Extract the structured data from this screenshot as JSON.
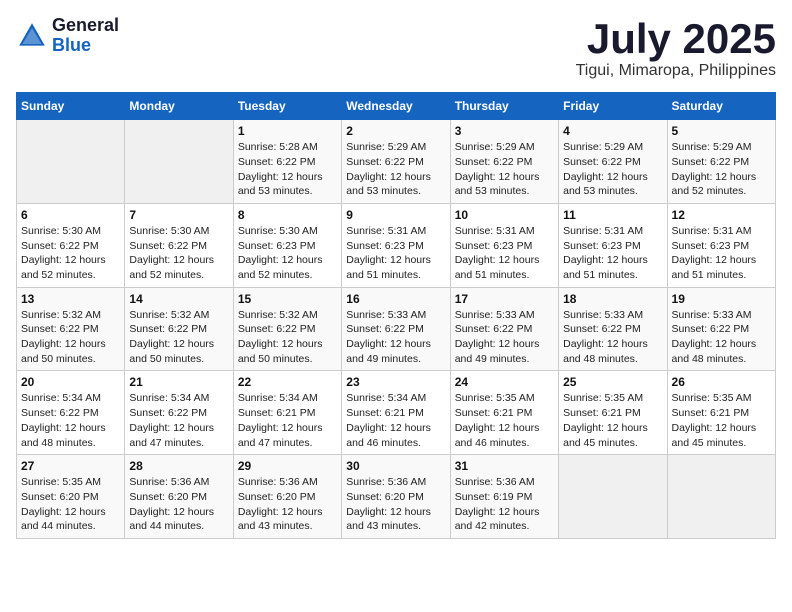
{
  "header": {
    "logo_line1": "General",
    "logo_line2": "Blue",
    "month": "July 2025",
    "location": "Tigui, Mimaropa, Philippines"
  },
  "weekdays": [
    "Sunday",
    "Monday",
    "Tuesday",
    "Wednesday",
    "Thursday",
    "Friday",
    "Saturday"
  ],
  "weeks": [
    [
      {
        "day": "",
        "empty": true
      },
      {
        "day": "",
        "empty": true
      },
      {
        "day": "1",
        "sunrise": "5:28 AM",
        "sunset": "6:22 PM",
        "daylight": "12 hours and 53 minutes."
      },
      {
        "day": "2",
        "sunrise": "5:29 AM",
        "sunset": "6:22 PM",
        "daylight": "12 hours and 53 minutes."
      },
      {
        "day": "3",
        "sunrise": "5:29 AM",
        "sunset": "6:22 PM",
        "daylight": "12 hours and 53 minutes."
      },
      {
        "day": "4",
        "sunrise": "5:29 AM",
        "sunset": "6:22 PM",
        "daylight": "12 hours and 53 minutes."
      },
      {
        "day": "5",
        "sunrise": "5:29 AM",
        "sunset": "6:22 PM",
        "daylight": "12 hours and 52 minutes."
      }
    ],
    [
      {
        "day": "6",
        "sunrise": "5:30 AM",
        "sunset": "6:22 PM",
        "daylight": "12 hours and 52 minutes."
      },
      {
        "day": "7",
        "sunrise": "5:30 AM",
        "sunset": "6:22 PM",
        "daylight": "12 hours and 52 minutes."
      },
      {
        "day": "8",
        "sunrise": "5:30 AM",
        "sunset": "6:23 PM",
        "daylight": "12 hours and 52 minutes."
      },
      {
        "day": "9",
        "sunrise": "5:31 AM",
        "sunset": "6:23 PM",
        "daylight": "12 hours and 51 minutes."
      },
      {
        "day": "10",
        "sunrise": "5:31 AM",
        "sunset": "6:23 PM",
        "daylight": "12 hours and 51 minutes."
      },
      {
        "day": "11",
        "sunrise": "5:31 AM",
        "sunset": "6:23 PM",
        "daylight": "12 hours and 51 minutes."
      },
      {
        "day": "12",
        "sunrise": "5:31 AM",
        "sunset": "6:23 PM",
        "daylight": "12 hours and 51 minutes."
      }
    ],
    [
      {
        "day": "13",
        "sunrise": "5:32 AM",
        "sunset": "6:22 PM",
        "daylight": "12 hours and 50 minutes."
      },
      {
        "day": "14",
        "sunrise": "5:32 AM",
        "sunset": "6:22 PM",
        "daylight": "12 hours and 50 minutes."
      },
      {
        "day": "15",
        "sunrise": "5:32 AM",
        "sunset": "6:22 PM",
        "daylight": "12 hours and 50 minutes."
      },
      {
        "day": "16",
        "sunrise": "5:33 AM",
        "sunset": "6:22 PM",
        "daylight": "12 hours and 49 minutes."
      },
      {
        "day": "17",
        "sunrise": "5:33 AM",
        "sunset": "6:22 PM",
        "daylight": "12 hours and 49 minutes."
      },
      {
        "day": "18",
        "sunrise": "5:33 AM",
        "sunset": "6:22 PM",
        "daylight": "12 hours and 48 minutes."
      },
      {
        "day": "19",
        "sunrise": "5:33 AM",
        "sunset": "6:22 PM",
        "daylight": "12 hours and 48 minutes."
      }
    ],
    [
      {
        "day": "20",
        "sunrise": "5:34 AM",
        "sunset": "6:22 PM",
        "daylight": "12 hours and 48 minutes."
      },
      {
        "day": "21",
        "sunrise": "5:34 AM",
        "sunset": "6:22 PM",
        "daylight": "12 hours and 47 minutes."
      },
      {
        "day": "22",
        "sunrise": "5:34 AM",
        "sunset": "6:21 PM",
        "daylight": "12 hours and 47 minutes."
      },
      {
        "day": "23",
        "sunrise": "5:34 AM",
        "sunset": "6:21 PM",
        "daylight": "12 hours and 46 minutes."
      },
      {
        "day": "24",
        "sunrise": "5:35 AM",
        "sunset": "6:21 PM",
        "daylight": "12 hours and 46 minutes."
      },
      {
        "day": "25",
        "sunrise": "5:35 AM",
        "sunset": "6:21 PM",
        "daylight": "12 hours and 45 minutes."
      },
      {
        "day": "26",
        "sunrise": "5:35 AM",
        "sunset": "6:21 PM",
        "daylight": "12 hours and 45 minutes."
      }
    ],
    [
      {
        "day": "27",
        "sunrise": "5:35 AM",
        "sunset": "6:20 PM",
        "daylight": "12 hours and 44 minutes."
      },
      {
        "day": "28",
        "sunrise": "5:36 AM",
        "sunset": "6:20 PM",
        "daylight": "12 hours and 44 minutes."
      },
      {
        "day": "29",
        "sunrise": "5:36 AM",
        "sunset": "6:20 PM",
        "daylight": "12 hours and 43 minutes."
      },
      {
        "day": "30",
        "sunrise": "5:36 AM",
        "sunset": "6:20 PM",
        "daylight": "12 hours and 43 minutes."
      },
      {
        "day": "31",
        "sunrise": "5:36 AM",
        "sunset": "6:19 PM",
        "daylight": "12 hours and 42 minutes."
      },
      {
        "day": "",
        "empty": true
      },
      {
        "day": "",
        "empty": true
      }
    ]
  ]
}
